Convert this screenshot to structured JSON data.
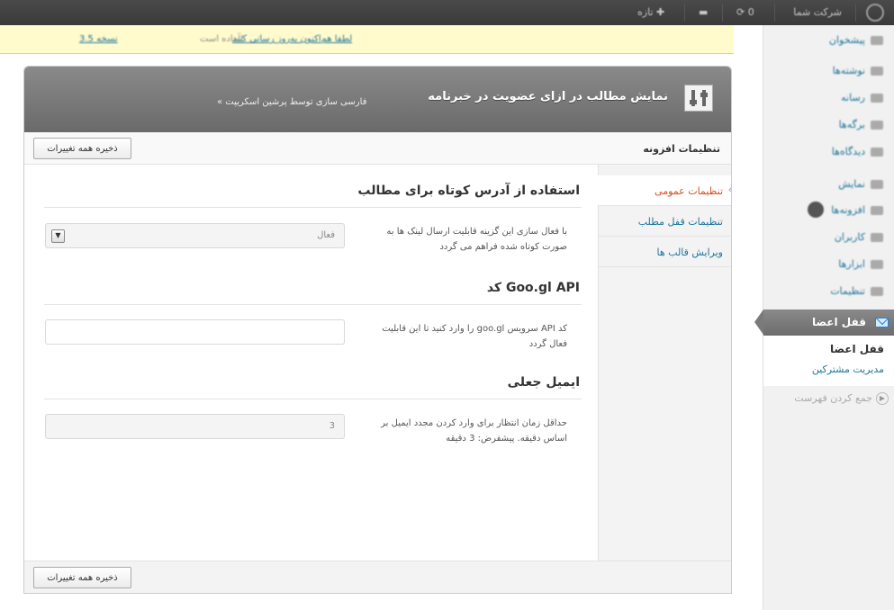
{
  "adminbar": {
    "site_name": "شرکت شما",
    "updates": "0",
    "new_label": "تازه"
  },
  "notice": {
    "version_link": "نسخه 3.5",
    "available_text": "آماده است!",
    "update_link": "لطفا هم‌اکنون به‌روز رسانی کنید"
  },
  "sidebar": {
    "items": [
      {
        "label": "پیشخوان"
      },
      {
        "label": "نوشته‌ها"
      },
      {
        "label": "رسانه"
      },
      {
        "label": "برگه‌ها"
      },
      {
        "label": "دیدگاه‌ها"
      },
      {
        "label": "نمایش"
      },
      {
        "label": "افزونه‌ها"
      },
      {
        "label": "کاربران"
      },
      {
        "label": "ابزارها"
      },
      {
        "label": "تنظیمات"
      }
    ],
    "active_menu": "قفل اعضا",
    "submenu_title": "قفل اعضا",
    "submenu_link": "مدیریت مشترکین",
    "collapse_label": "جمع کردن فهرست"
  },
  "panel": {
    "title": "نمایش مطالب در ازای عضویت در خبرنامه",
    "subtitle": "« فارسی سازی توسط پرشین اسکریپت",
    "heading": "تنظیمات افزونه",
    "save_label": "ذخیره همه تغییرات",
    "tabs": [
      {
        "label": "تنظیمات عمومی",
        "active": true
      },
      {
        "label": "تنظیمات قفل مطلب",
        "active": false
      },
      {
        "label": "ویرایش قالب ها",
        "active": false
      }
    ],
    "sections": [
      {
        "title": "استفاده از آدرس کوتاه برای مطالب",
        "description": "با فعال سازی این گزینه قابلیت ارسال لینک ها به صورت کوتاه شده فراهم می گردد",
        "value": "فعال"
      },
      {
        "title": "کد Goo.gl API",
        "description": "کد API سرویس goo.gl را وارد کنید تا این قابلیت فعال گردد",
        "value": ""
      },
      {
        "title": "ایمیل جعلی",
        "description": "حداقل زمان انتظار برای وارد کردن مجدد ایمیل بر اساس دقیقه. پیشفرض: 3 دقیقه",
        "value": "3"
      }
    ]
  }
}
